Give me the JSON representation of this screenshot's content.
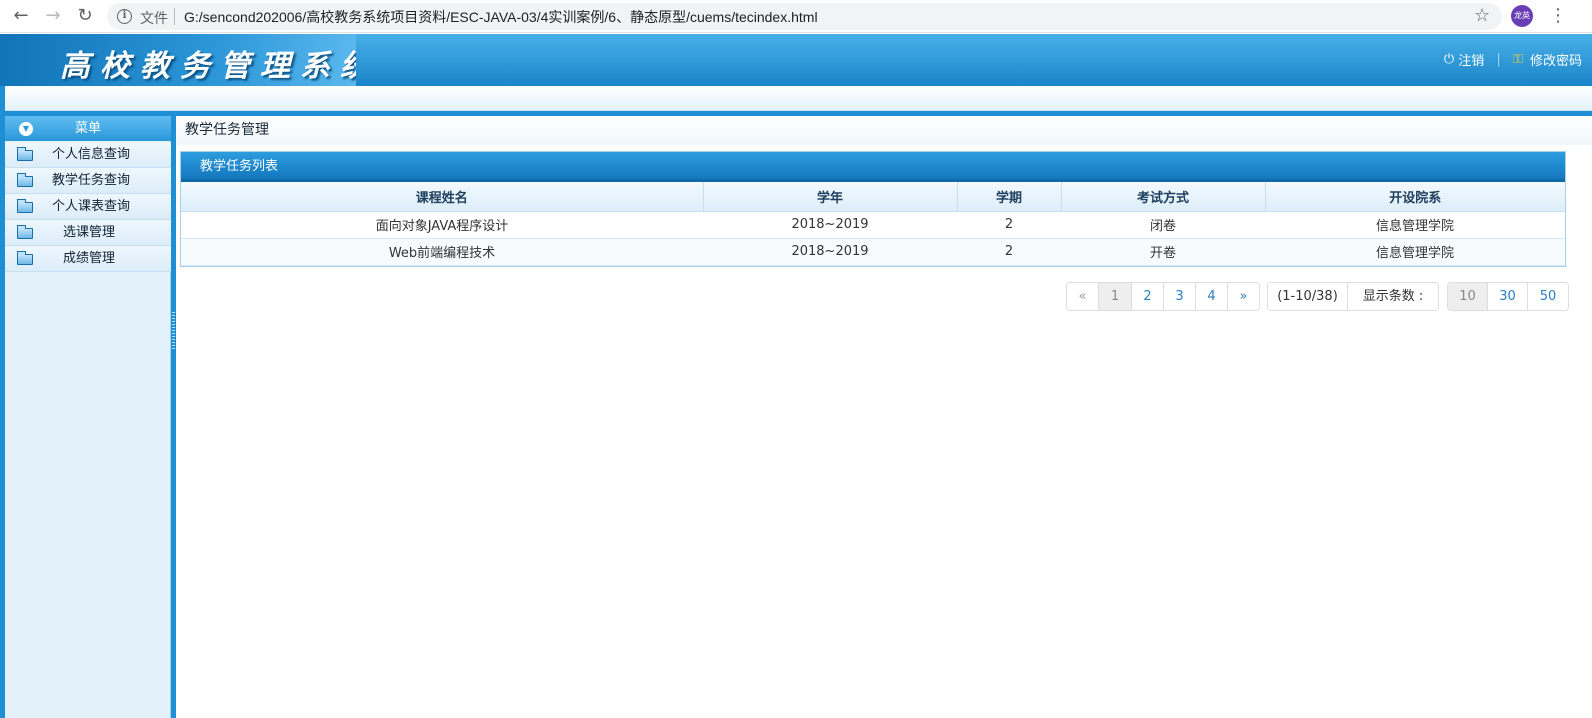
{
  "browser": {
    "back_glyph": "←",
    "forward_glyph": "→",
    "reload_glyph": "↻",
    "file_label": "文件",
    "url": "G:/sencond202006/高校教务系统项目资料/ESC-JAVA-03/4实训案例/6、静态原型/cuems/tecindex.html",
    "star_glyph": "☆",
    "profile_label": "龙英",
    "menu_glyph": "⋮"
  },
  "header": {
    "logo_text": "高校教务管理系统",
    "logout_label": "注销",
    "change_password_label": "修改密码",
    "separator": "|"
  },
  "sidebar": {
    "title": "菜单",
    "items": [
      {
        "label": "个人信息查询"
      },
      {
        "label": "教学任务查询"
      },
      {
        "label": "个人课表查询"
      },
      {
        "label": "选课管理"
      },
      {
        "label": "成绩管理"
      }
    ]
  },
  "main": {
    "page_title": "教学任务管理",
    "panel_title": "教学任务列表",
    "columns": [
      "课程姓名",
      "学年",
      "学期",
      "考试方式",
      "开设院系"
    ],
    "rows": [
      [
        "面向对象JAVA程序设计",
        "2018~2019",
        "2",
        "闭卷",
        "信息管理学院"
      ],
      [
        "Web前端编程技术",
        "2018~2019",
        "2",
        "开卷",
        "信息管理学院"
      ]
    ]
  },
  "pagination": {
    "prev": "«",
    "pages": [
      "1",
      "2",
      "3",
      "4"
    ],
    "current_page": "1",
    "next": "»",
    "range_text": "(1-10/38)",
    "page_size_label": "显示条数 :",
    "page_sizes": [
      "10",
      "30",
      "50"
    ],
    "current_page_size": "10"
  },
  "colors": {
    "header_blue": "#1a85c9",
    "accent_blue": "#1e8fd4",
    "link_blue": "#2a7ec0"
  }
}
